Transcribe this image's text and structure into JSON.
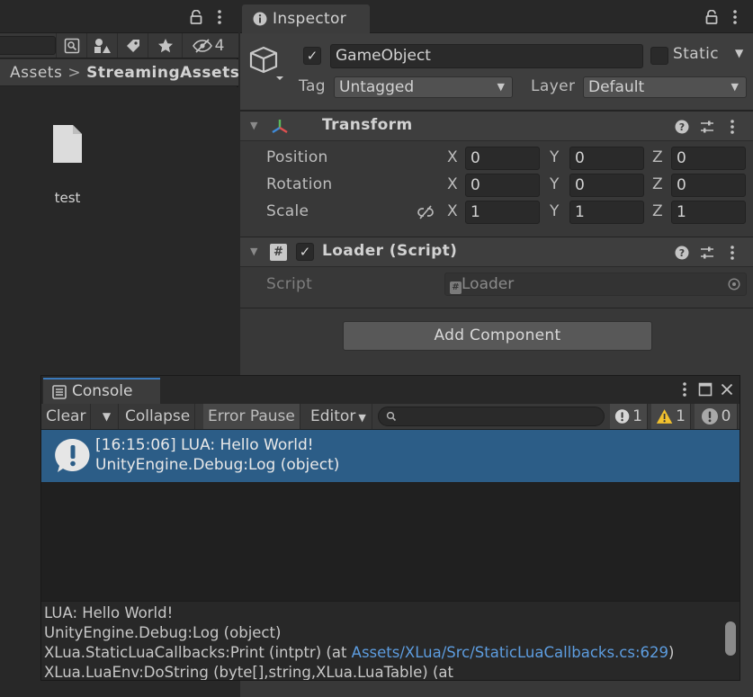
{
  "project": {
    "hidden_count": "4",
    "breadcrumb": [
      "Assets",
      "StreamingAssets"
    ],
    "breadcrumb_separator": ">",
    "files": [
      {
        "name": "test",
        "icon": "file-icon"
      }
    ]
  },
  "inspector": {
    "tab_label": "Inspector",
    "gameobject": {
      "active": true,
      "name": "GameObject",
      "static_label": "Static",
      "static": false,
      "tag_label": "Tag",
      "tag_value": "Untagged",
      "layer_label": "Layer",
      "layer_value": "Default"
    },
    "transform": {
      "title": "Transform",
      "rows": [
        {
          "label": "Position",
          "x": "0",
          "y": "0",
          "z": "0"
        },
        {
          "label": "Rotation",
          "x": "0",
          "y": "0",
          "z": "0"
        },
        {
          "label": "Scale",
          "x": "1",
          "y": "1",
          "z": "1"
        }
      ],
      "axis_labels": [
        "X",
        "Y",
        "Z"
      ]
    },
    "loader": {
      "title": "Loader (Script)",
      "enabled": true,
      "script_label": "Script",
      "script_value": "Loader"
    },
    "add_component_label": "Add Component"
  },
  "console": {
    "tab_label": "Console",
    "toolbar": {
      "clear": "Clear",
      "collapse": "Collapse",
      "error_pause": "Error Pause",
      "editor": "Editor",
      "search_placeholder": "",
      "info_count": "1",
      "warning_count": "1",
      "error_count": "0"
    },
    "entries": [
      {
        "line1": "[16:15:06] LUA: Hello World!",
        "line2": "UnityEngine.Debug:Log (object)"
      }
    ],
    "stacktrace": {
      "line1": "LUA: Hello World!",
      "line2": "UnityEngine.Debug:Log (object)",
      "line3_prefix": "XLua.StaticLuaCallbacks:Print (intptr) (at ",
      "line3_link": "Assets/XLua/Src/StaticLuaCallbacks.cs:629",
      "line3_suffix": ")",
      "line4": "XLua.LuaEnv:DoString (byte[],string,XLua.LuaTable) (at"
    },
    "colors": {
      "selected_row": "#2c5d87",
      "link": "#5d9de0",
      "tab_accent": "#3a79bb"
    }
  }
}
